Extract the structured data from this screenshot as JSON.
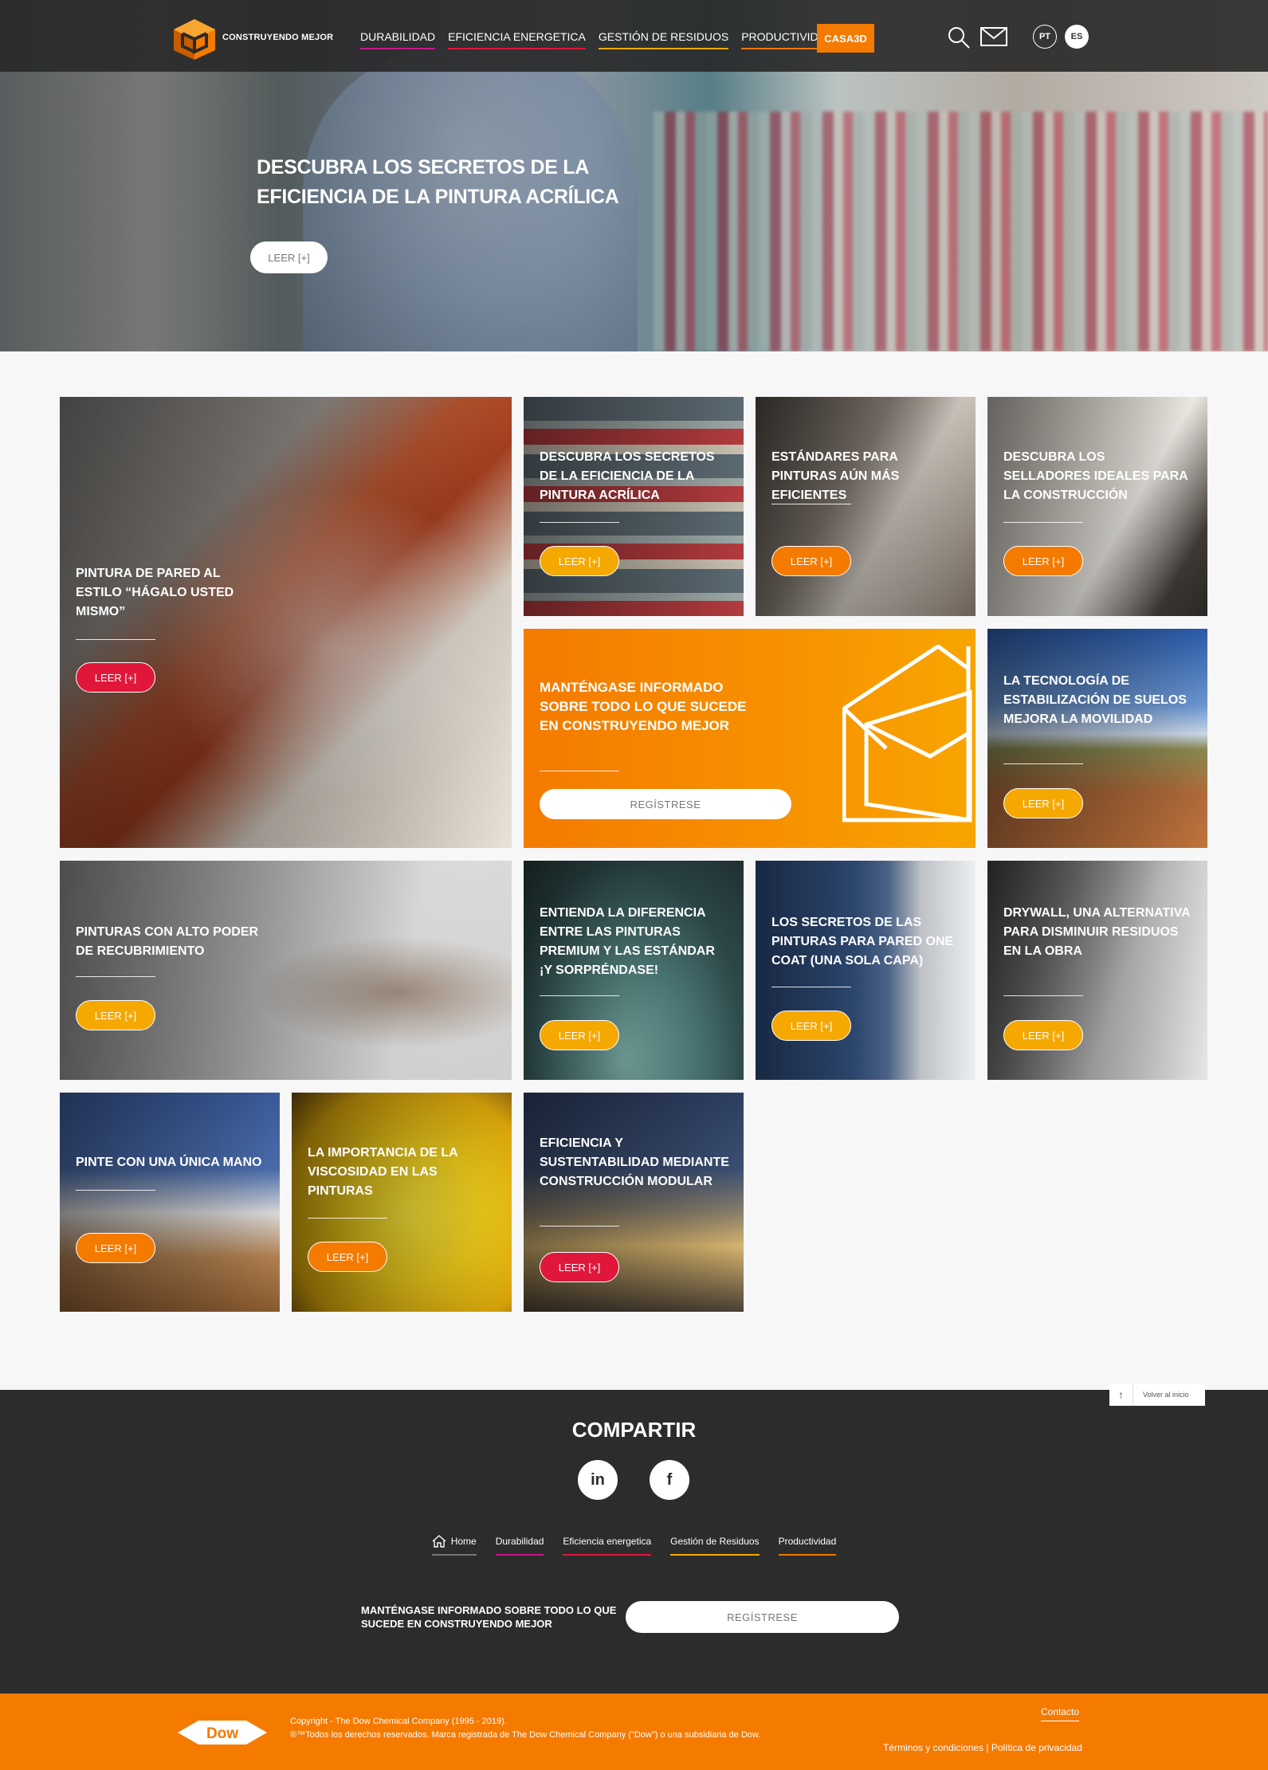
{
  "header": {
    "logo_text": "CONSTRUYENDO MEJOR",
    "nav": [
      {
        "label": "DURABILIDAD",
        "color": "#c8178a"
      },
      {
        "label": "EFICIENCIA ENERGETICA",
        "color": "#e0173a"
      },
      {
        "label": "GESTIÓN DE RESIDUOS",
        "color": "#f5a800"
      },
      {
        "label": "PRODUCTIVIDAD",
        "color": "#f07800"
      }
    ],
    "cta": "CASA3D",
    "languages": [
      "PT",
      "ES"
    ],
    "icons": [
      "search-icon",
      "mail-icon"
    ]
  },
  "hero": {
    "title": "DESCUBRA LOS SECRETOS DE LA EFICIENCIA DE LA PINTURA ACRÍLICA",
    "button": "LEER [+]"
  },
  "cards": [
    {
      "title": "PINTURA DE PARED AL ESTILO “HÁGALO USTED MISMO”",
      "button": "LEER [+]",
      "button_color": "red"
    },
    {
      "title": "DESCUBRA LOS SECRETOS DE LA EFICIENCIA DE LA PINTURA ACRÍLICA",
      "button": "LEER [+]",
      "button_color": "yellow"
    },
    {
      "title": "ESTÁNDARES PARA PINTURAS AÚN MÁS EFICIENTES",
      "button": "LEER [+]",
      "button_color": "orange"
    },
    {
      "title": "DESCUBRA LOS SELLADORES IDEALES PARA LA CONSTRUCCIÓN",
      "button": "LEER [+]",
      "button_color": "orange"
    },
    {
      "title": "LA TECNOLOGÍA DE ESTABILIZACIÓN DE SUELOS MEJORA LA MOVILIDAD",
      "button": "LEER [+]",
      "button_color": "yellow"
    },
    {
      "title": "PINTURAS CON ALTO PODER DE RECUBRIMIENTO",
      "button": "LEER [+]",
      "button_color": "yellow"
    },
    {
      "title": "ENTIENDA LA DIFERENCIA ENTRE LAS PINTURAS PREMIUM Y LAS ESTÁNDAR ¡Y SORPRÉNDASE!",
      "button": "LEER [+]",
      "button_color": "yellow"
    },
    {
      "title": "LOS SECRETOS DE LAS PINTURAS PARA PARED ONE COAT (UNA SOLA CAPA)",
      "button": "LEER [+]",
      "button_color": "yellow"
    },
    {
      "title": "DRYWALL, UNA ALTERNATIVA PARA DISMINUIR RESIDUOS EN LA OBRA",
      "button": "LEER [+]",
      "button_color": "yellow"
    },
    {
      "title": "PINTE CON UNA ÚNICA MANO",
      "button": "LEER [+]",
      "button_color": "orange"
    },
    {
      "title": "LA IMPORTANCIA DE LA VISCOSIDAD EN LAS PINTURAS",
      "button": "LEER [+]",
      "button_color": "orange"
    },
    {
      "title": "EFICIENCIA Y SUSTENTABILIDAD MEDIANTE CONSTRUCCIÓN MODULAR",
      "button": "LEER [+]",
      "button_color": "red"
    }
  ],
  "newsletter": {
    "title": "MANTÉNGASE INFORMADO SOBRE TODO LO QUE SUCEDE EN CONSTRUYENDO MEJOR",
    "button": "REGÍSTRESE"
  },
  "footer": {
    "back_to_top": "Volver al inicio",
    "share_title": "COMPARTIR",
    "social": [
      "in",
      "f"
    ],
    "nav": [
      {
        "label": "Home",
        "color": "#777777"
      },
      {
        "label": "Durabilidad",
        "color": "#c8178a"
      },
      {
        "label": "Eficiencia energetica",
        "color": "#e0173a"
      },
      {
        "label": "Gestión de Residuos",
        "color": "#f5a800"
      },
      {
        "label": "Productividad",
        "color": "#f07800"
      }
    ],
    "newsletter_text": "MANTÉNGASE INFORMADO SOBRE TODO LO QUE SUCEDE EN CONSTRUYENDO MEJOR",
    "newsletter_button": "REGÍSTRESE"
  },
  "bottom": {
    "logo_text": "Dow",
    "copyright_1": "Copyright - The Dow Chemical Company (1995 - 2019).",
    "copyright_2": "®™Todos los derechos reservados. Marca registrada de The Dow Chemical Company (\"Dow\") o una subsidiaria de Dow.",
    "contact": "Contacto",
    "legal": "Términos y condiciones | Política de privacidad"
  }
}
